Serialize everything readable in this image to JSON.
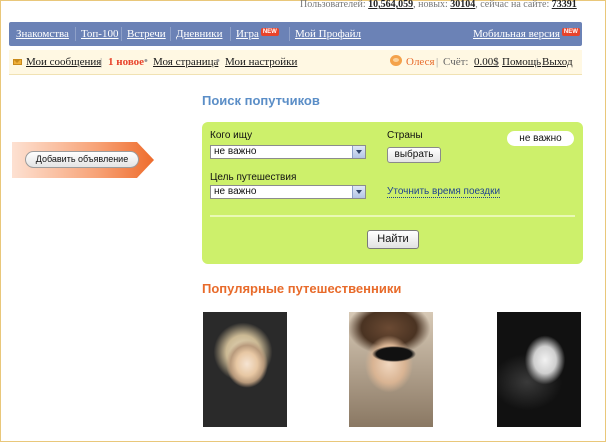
{
  "top_stats": {
    "users_label": "Пользователей:",
    "users_value": "10,564,059",
    "new_label": ", новых:",
    "new_value": "30104",
    "online_label": ", сейчас на сайте:",
    "online_value": "73391"
  },
  "nav": {
    "items": [
      "Знакомства",
      "Топ-100",
      "Встречи",
      "Дневники",
      "Игра",
      "Мой Профайл"
    ],
    "mobile": "Мобильная версия",
    "badge": "NEW"
  },
  "subnav": {
    "messages": "Мои сообщения",
    "new_count": "1 новое",
    "my_page": "Моя страница",
    "settings": "Мои настройки",
    "user": "Олеся",
    "balance_label": "Счёт:",
    "balance": "0.00$",
    "help": "Помощь",
    "logout": "Выход"
  },
  "add_ad_button": "Добавить объявление",
  "search": {
    "title": "Поиск попутчиков",
    "who_label": "Кого ищу",
    "who_value": "не важно",
    "purpose_label": "Цель путешествия",
    "purpose_value": "не важно",
    "countries_label": "Страны",
    "countries_value": "не важно",
    "choose_button": "выбрать",
    "refine_time": "Уточнить время поездки",
    "find_button": "Найти"
  },
  "popular": {
    "title": "Популярные путешественники"
  },
  "colors": {
    "nav_bg": "#6b82b6",
    "panel_bg": "#cdf06b",
    "search_title": "#5b8ec7",
    "popular_title": "#e86b2b",
    "accent_new": "#e8432b"
  }
}
